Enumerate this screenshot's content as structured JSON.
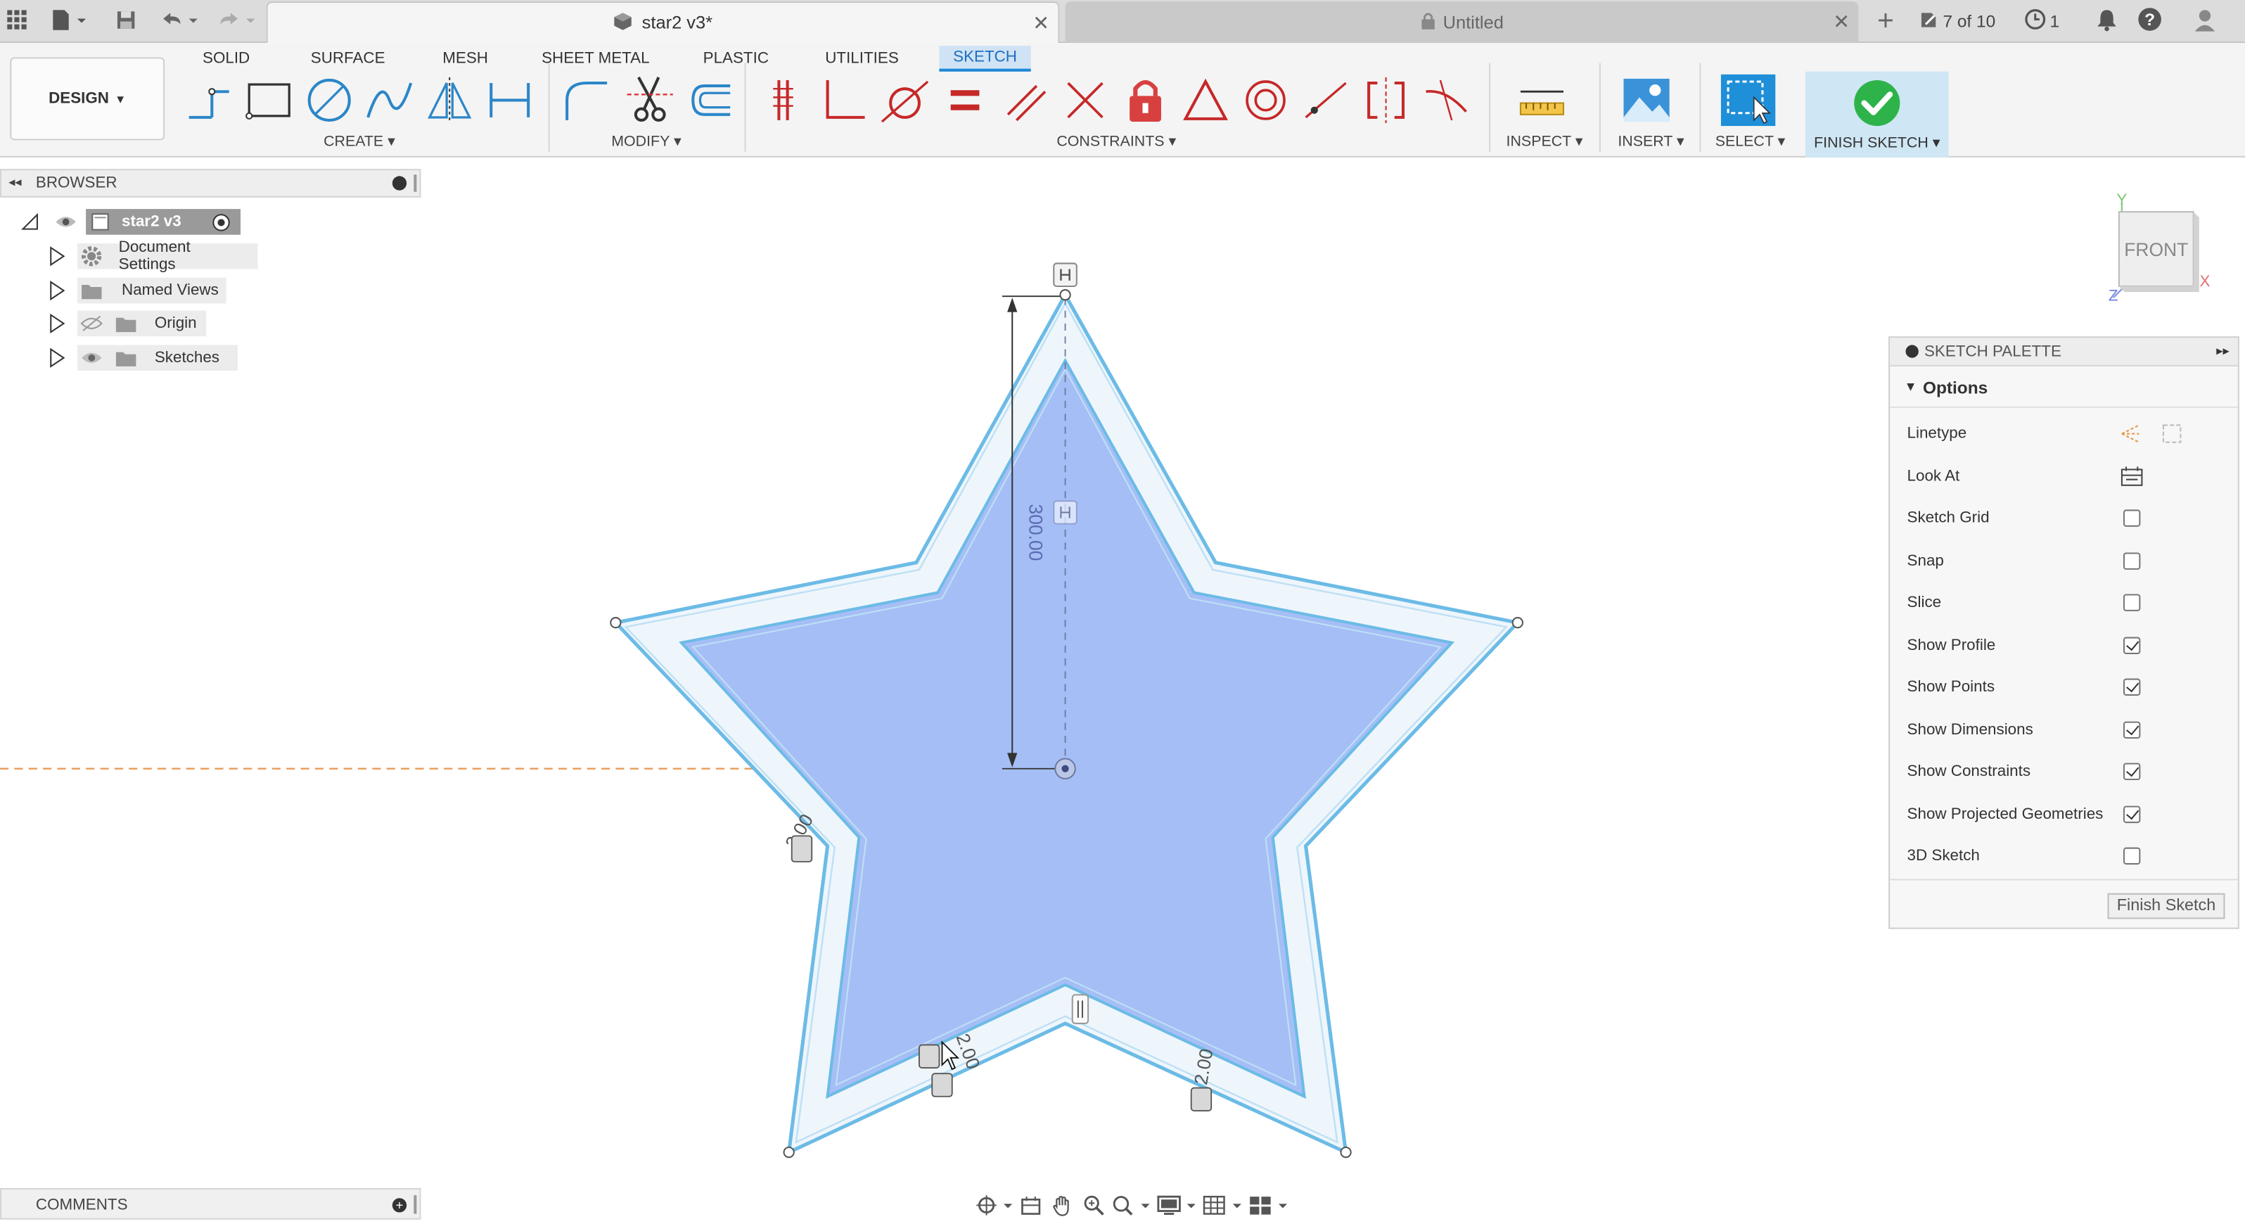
{
  "tabbar": {
    "active_doc": "star2 v3*",
    "inactive_doc": "Untitled",
    "job_status": "7 of 10",
    "clock_count": "1"
  },
  "ribbon": {
    "workspace": "DESIGN",
    "tabs": [
      "SOLID",
      "SURFACE",
      "MESH",
      "SHEET METAL",
      "PLASTIC",
      "UTILITIES",
      "SKETCH"
    ],
    "active_tab": "SKETCH",
    "groups": {
      "create": "CREATE",
      "modify": "MODIFY",
      "constraints": "CONSTRAINTS",
      "inspect": "INSPECT",
      "insert": "INSERT",
      "select": "SELECT",
      "finish": "FINISH SKETCH"
    },
    "colors": {
      "accent": "#1e8fd8",
      "finish_green": "#2db34a",
      "sketch_line": "#5aafe0",
      "profile_fill": "#9fb9f5"
    }
  },
  "browser": {
    "title": "BROWSER",
    "root": "star2 v3",
    "items": [
      "Document Settings",
      "Named Views",
      "Origin",
      "Sketches"
    ]
  },
  "sketch": {
    "dimension_height": "300.00",
    "offset_label": "2.00"
  },
  "viewcube": {
    "face": "FRONT",
    "axis_x": "X",
    "axis_y": "Y",
    "axis_z": "Z"
  },
  "palette": {
    "title": "SKETCH PALETTE",
    "section": "Options",
    "rows": [
      {
        "label": "Linetype"
      },
      {
        "label": "Look At"
      },
      {
        "label": "Sketch Grid",
        "checked": false
      },
      {
        "label": "Snap",
        "checked": false
      },
      {
        "label": "Slice",
        "checked": false
      },
      {
        "label": "Show Profile",
        "checked": true
      },
      {
        "label": "Show Points",
        "checked": true
      },
      {
        "label": "Show Dimensions",
        "checked": true
      },
      {
        "label": "Show Constraints",
        "checked": true
      },
      {
        "label": "Show Projected Geometries",
        "checked": true
      },
      {
        "label": "3D Sketch",
        "checked": false
      }
    ],
    "finish_label": "Finish Sketch"
  },
  "comments": {
    "title": "COMMENTS"
  }
}
